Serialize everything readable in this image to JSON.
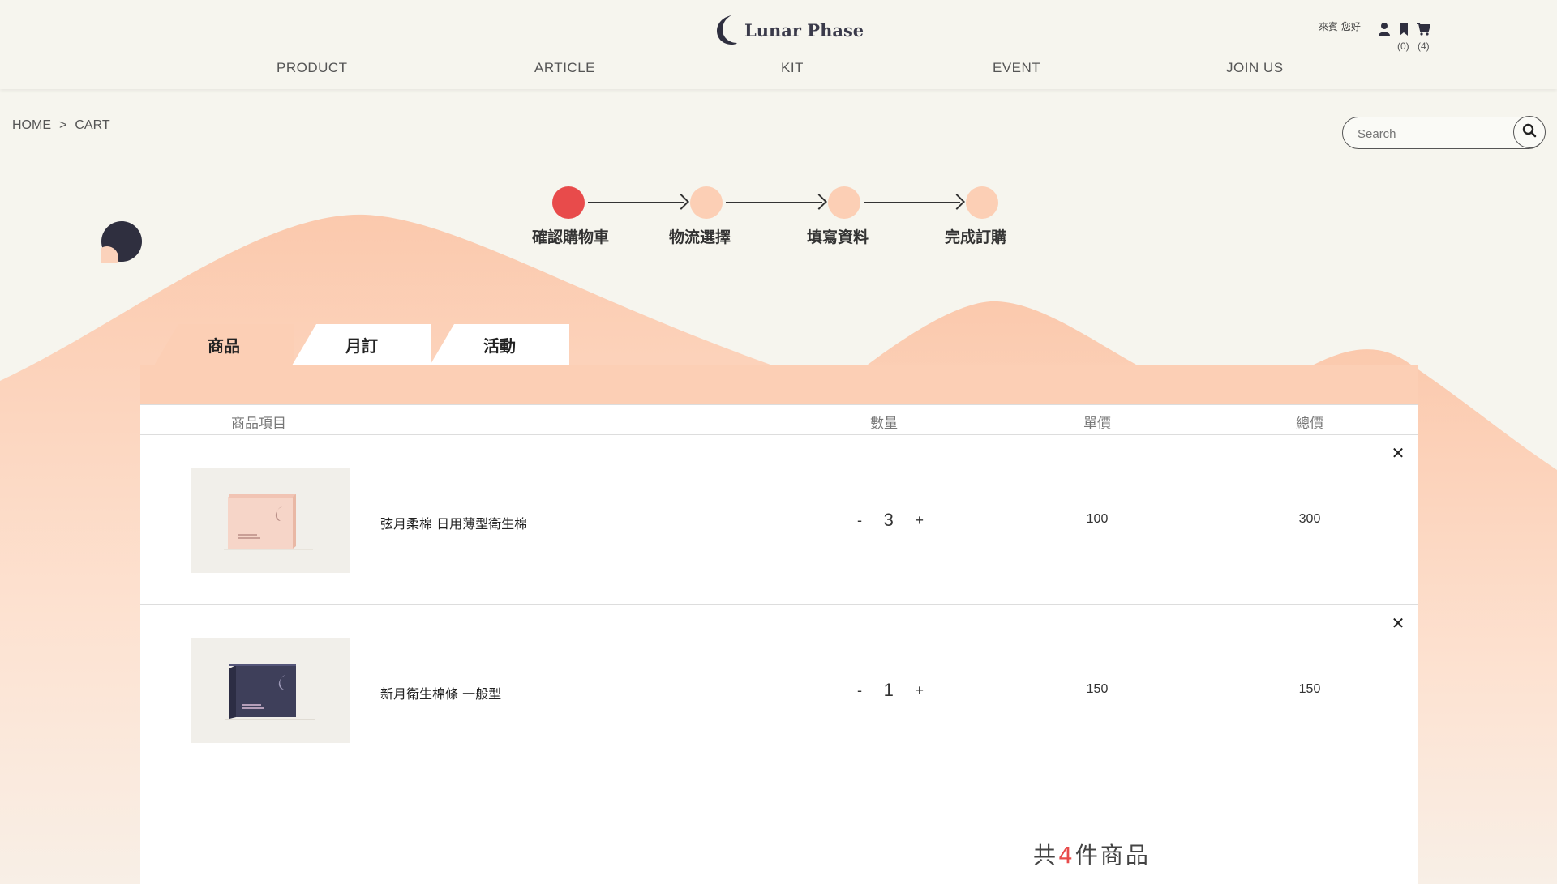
{
  "header": {
    "brand": "Lunar Phase",
    "nav": [
      "PRODUCT",
      "ARTICLE",
      "KIT",
      "EVENT",
      "JOIN US"
    ],
    "greeting": "來賓 您好",
    "bookmark_count": "(0)",
    "cart_count": "(4)"
  },
  "breadcrumb": {
    "home": "HOME",
    "sep": ">",
    "current": "CART"
  },
  "search": {
    "placeholder": "Search"
  },
  "steps": [
    "確認購物車",
    "物流選擇",
    "填寫資料",
    "完成訂購"
  ],
  "tabs": [
    "商品",
    "月訂",
    "活動"
  ],
  "table": {
    "headers": {
      "item": "商品項目",
      "qty": "數量",
      "unit": "單價",
      "total": "總價"
    }
  },
  "items": [
    {
      "name": "弦月柔棉 日用薄型衛生棉",
      "qty": "3",
      "unit_price": "100",
      "total": "300",
      "minus": "-",
      "plus": "+"
    },
    {
      "name": "新月衛生棉條 一般型",
      "qty": "1",
      "unit_price": "150",
      "total": "150",
      "minus": "-",
      "plus": "+"
    }
  ],
  "summary": {
    "prefix": "共",
    "count": "4",
    "suffix": "件商品"
  },
  "colors": {
    "accent": "#e84b4b",
    "peach": "#fccfb5",
    "background": "#f6f5ee",
    "dark": "#2f2f3f"
  }
}
